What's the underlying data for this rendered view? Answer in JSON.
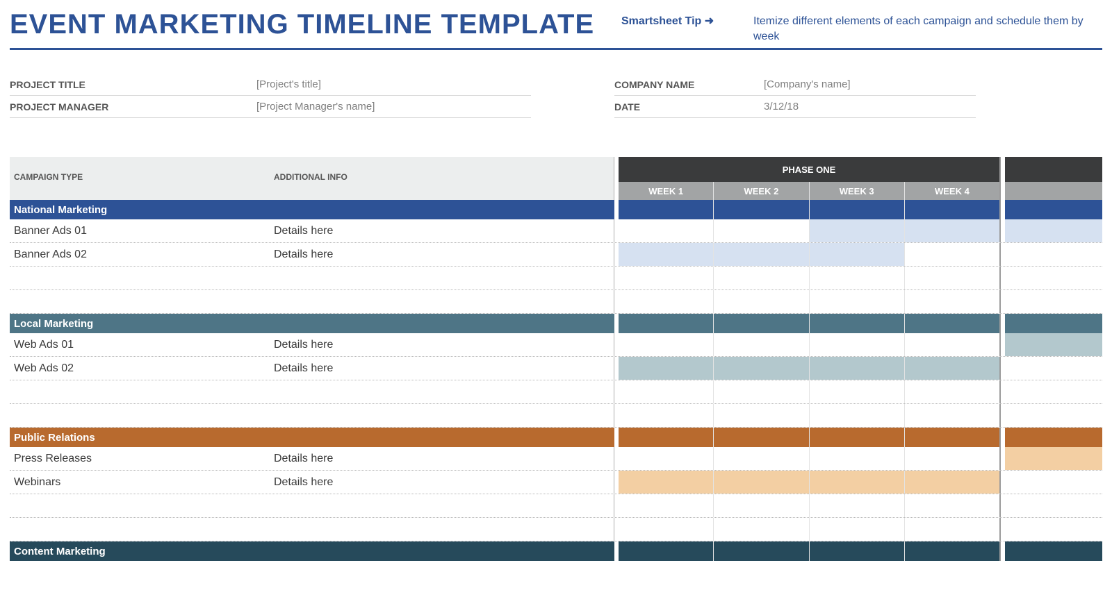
{
  "header": {
    "title": "EVENT MARKETING TIMELINE TEMPLATE",
    "tip_label": "Smartsheet Tip",
    "tip_arrow": "➜",
    "tip_desc": "Itemize different elements of each campaign and schedule them by week"
  },
  "meta": {
    "project_title_label": "PROJECT TITLE",
    "project_title_value": "[Project's title]",
    "project_manager_label": "PROJECT MANAGER",
    "project_manager_value": "[Project Manager's name]",
    "company_name_label": "COMPANY NAME",
    "company_name_value": "[Company's name]",
    "date_label": "DATE",
    "date_value": "3/12/18"
  },
  "columns": {
    "campaign_type": "CAMPAIGN TYPE",
    "additional_info": "ADDITIONAL INFO",
    "phase": "PHASE ONE",
    "weeks": [
      "WEEK 1",
      "WEEK 2",
      "WEEK 3",
      "WEEK 4"
    ]
  },
  "sections": [
    {
      "name": "National Marketing",
      "band_class": "sec-nat",
      "fill_class": "sec-nat-l",
      "rows": [
        {
          "campaign": "Banner Ads 01",
          "info": "Details here",
          "weeks": [
            0,
            0,
            1,
            1
          ],
          "tail": 1
        },
        {
          "campaign": "Banner Ads 02",
          "info": "Details here",
          "weeks": [
            1,
            1,
            1,
            0
          ],
          "tail": 0
        }
      ],
      "blanks": 2
    },
    {
      "name": "Local Marketing",
      "band_class": "sec-loc",
      "fill_class": "sec-loc-l",
      "rows": [
        {
          "campaign": "Web Ads 01",
          "info": "Details here",
          "weeks": [
            0,
            0,
            0,
            0
          ],
          "tail": 1
        },
        {
          "campaign": "Web Ads 02",
          "info": "Details here",
          "weeks": [
            1,
            1,
            1,
            1
          ],
          "tail": 0
        }
      ],
      "blanks": 2
    },
    {
      "name": "Public Relations",
      "band_class": "sec-pr",
      "fill_class": "sec-pr-l",
      "rows": [
        {
          "campaign": "Press Releases",
          "info": "Details here",
          "weeks": [
            0,
            0,
            0,
            0
          ],
          "tail": 1
        },
        {
          "campaign": "Webinars",
          "info": "Details here",
          "weeks": [
            1,
            1,
            1,
            1
          ],
          "tail": 0
        }
      ],
      "blanks": 2
    },
    {
      "name": "Content Marketing",
      "band_class": "sec-cm",
      "fill_class": "",
      "rows": [],
      "blanks": 0
    }
  ]
}
